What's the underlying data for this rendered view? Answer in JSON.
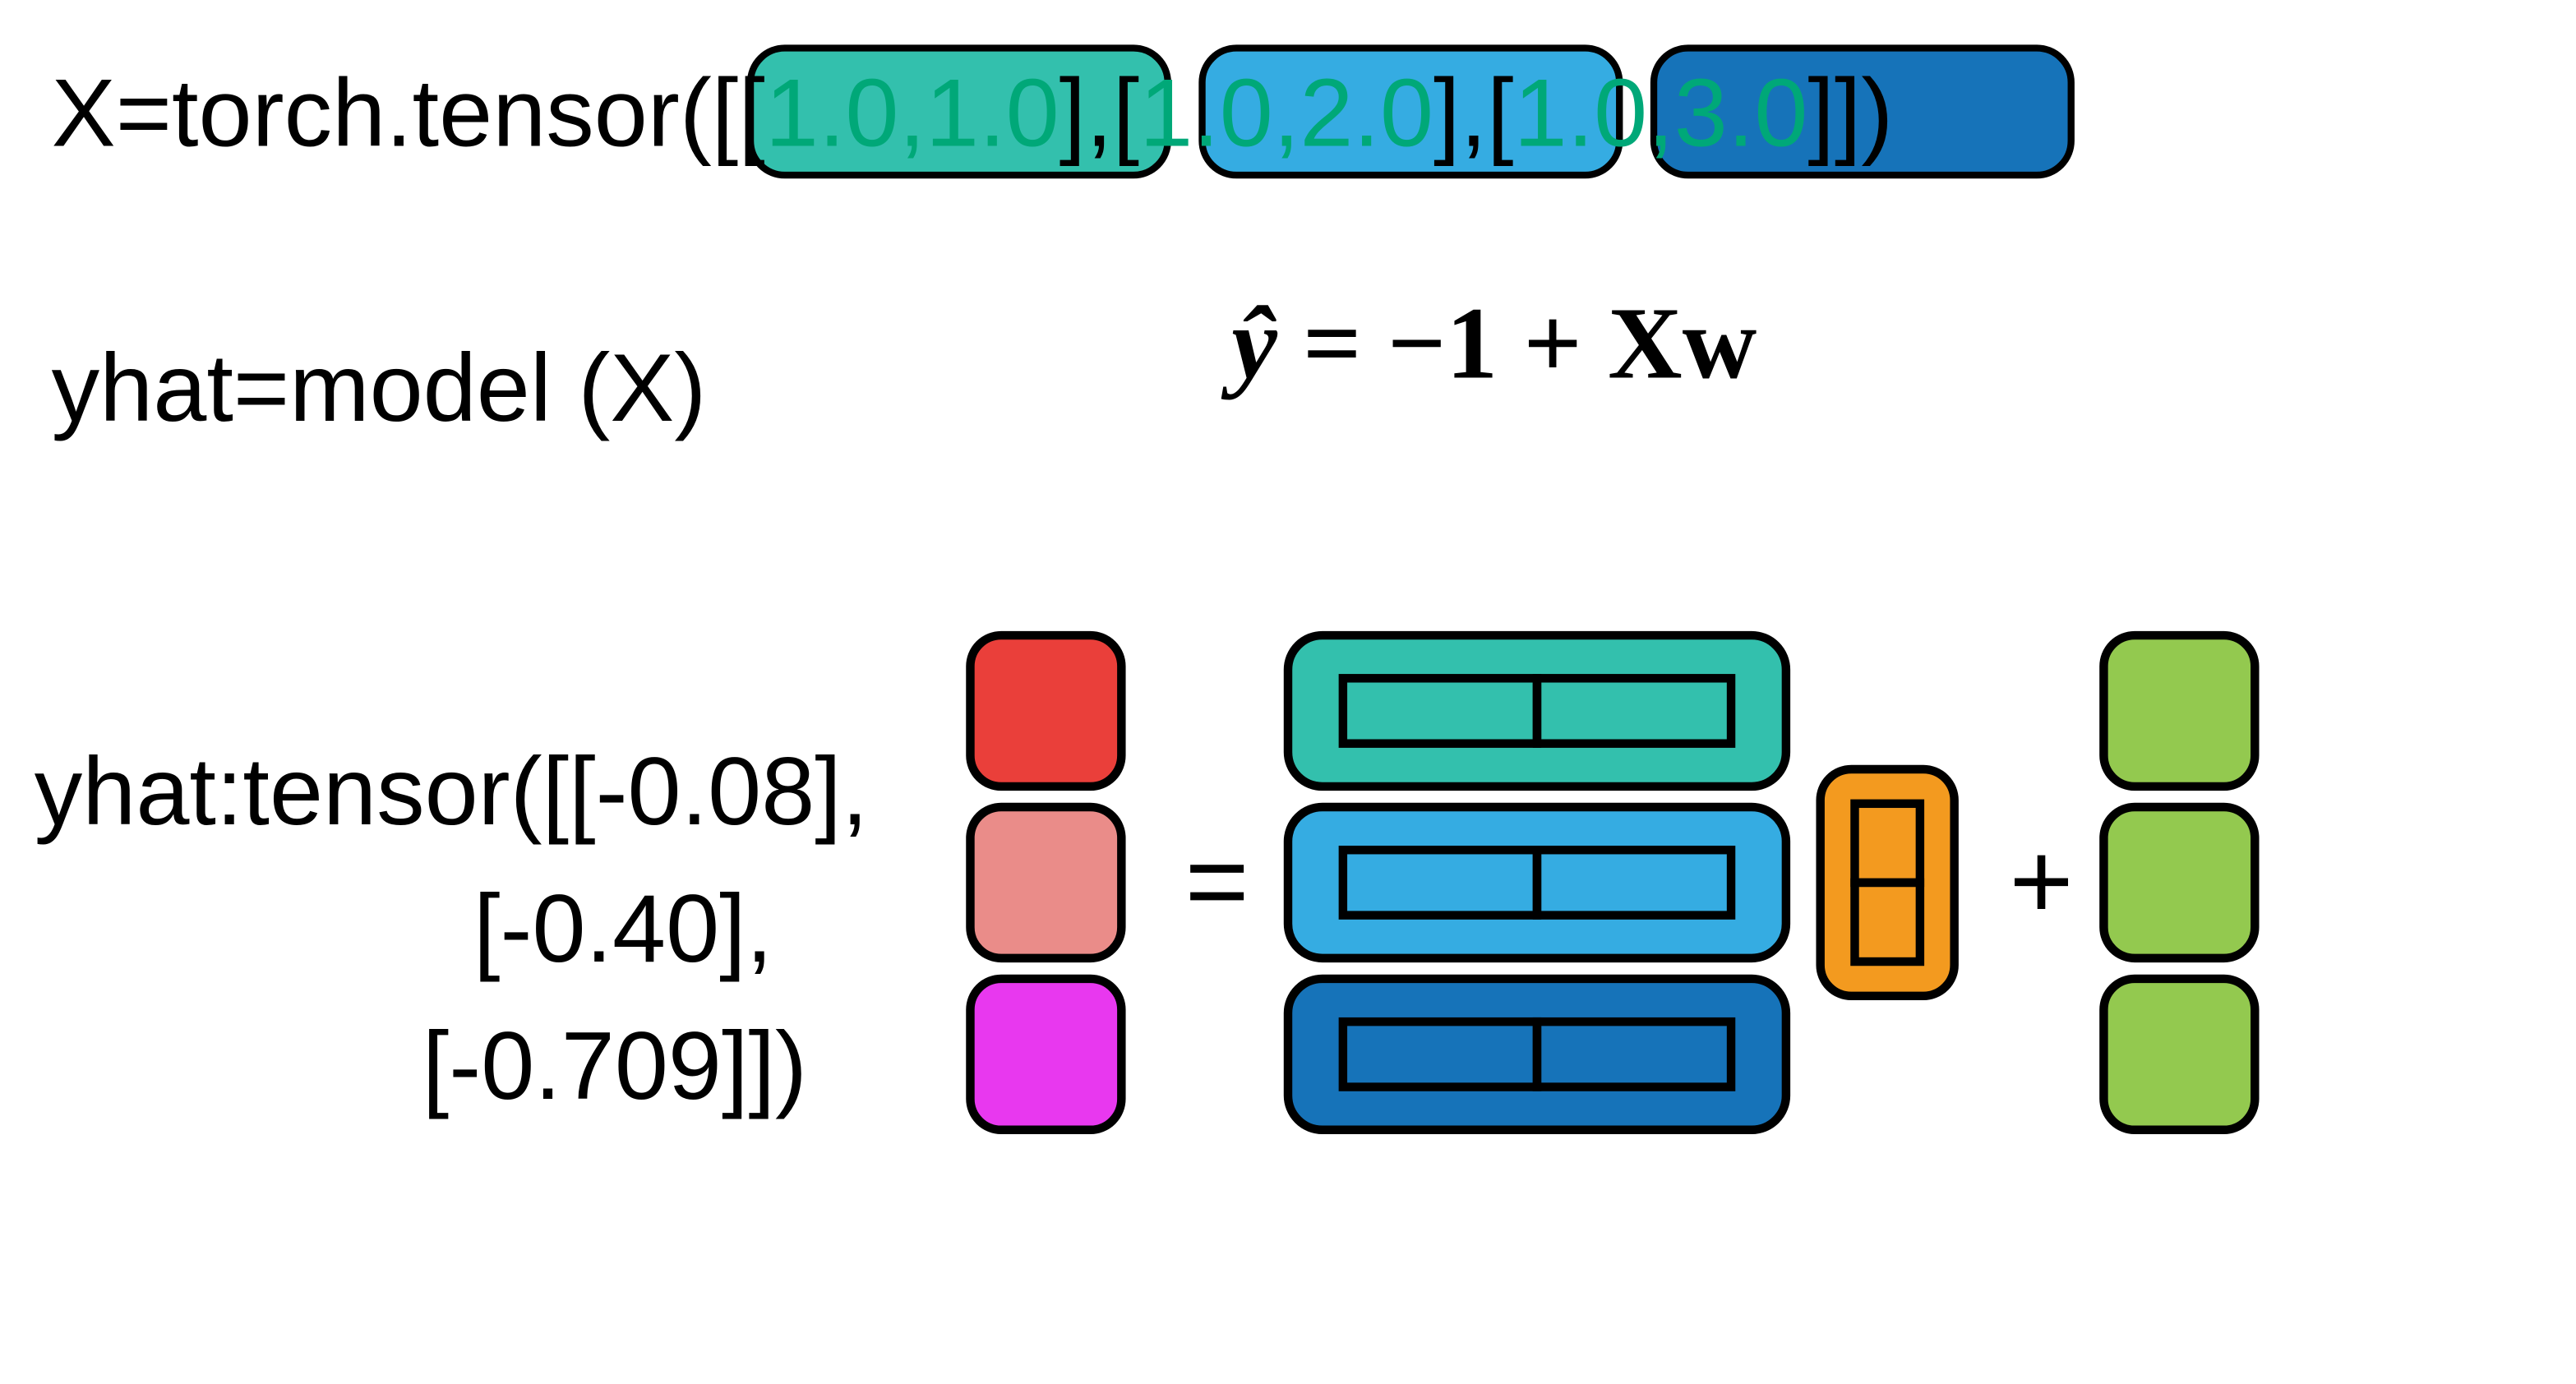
{
  "line_x": {
    "prefix": "X=torch.tensor([",
    "p1": {
      "open": "[",
      "a": "1.0",
      "c": ",",
      "b": "1.0",
      "close": "]"
    },
    "sep12": ",",
    "p2": {
      "open": "[",
      "a": "1.0",
      "c": ",",
      "b": "2.0",
      "close": "]"
    },
    "sep23": ",",
    "p3": {
      "open": "[",
      "a": "1.0",
      "c": ",",
      "b": "3.0",
      "close": "]"
    },
    "suffix": "])"
  },
  "line_call": "yhat=model (X)",
  "equation": {
    "yhat": "ŷ",
    "eq": " = ",
    "minus1": "−1",
    "plus": " +  ",
    "Xw": "Xw"
  },
  "line_result": {
    "head": "yhat:tensor([[-0.08],",
    "mid": "[-0.40],",
    "tail": "[-0.709]])"
  },
  "ops": {
    "eq": "=",
    "plus": "+"
  },
  "colors": {
    "teal": "#33c0ad",
    "sky": "#35ace2",
    "blue": "#1673b9",
    "red": "#ea3f3a",
    "pink": "#ea8c89",
    "magenta": "#e838ef",
    "orange": "#f39a1f",
    "green": "#93c94f",
    "stroke": "#000000"
  }
}
